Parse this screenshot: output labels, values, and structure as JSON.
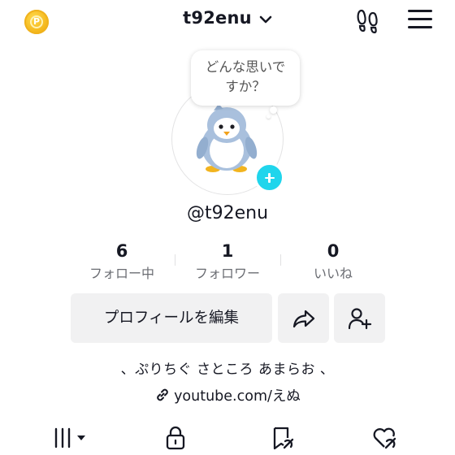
{
  "header": {
    "coin_icon": "coin-icon",
    "username": "t92enu",
    "dropdown_icon": "chevron-down-icon",
    "footprint_icon": "footprints-icon",
    "menu_icon": "hamburger-menu-icon"
  },
  "profile": {
    "thought_bubble": "どんな思いで\nすか？",
    "avatar": "penguin-avatar",
    "add_icon": "plus-icon",
    "handle": "@t92enu"
  },
  "stats": [
    {
      "value": "6",
      "label": "フォロー中"
    },
    {
      "value": "1",
      "label": "フォロワー"
    },
    {
      "value": "0",
      "label": "いいね"
    }
  ],
  "actions": {
    "edit_profile": "プロフィールを編集",
    "share_icon": "share-arrow-icon",
    "add_friend_icon": "add-friend-icon"
  },
  "bio": "、ぷりちぐ さところ あまらお 、",
  "link": {
    "icon": "link-icon",
    "text": "youtube.com/えぬ"
  },
  "tabs": [
    {
      "icon": "video-grid-icon",
      "active": true
    },
    {
      "icon": "lock-icon",
      "active": false
    },
    {
      "icon": "bookmark-icon",
      "active": false
    },
    {
      "icon": "liked-heart-icon",
      "active": false
    }
  ],
  "colors": {
    "accent_cyan": "#20d5ec",
    "text_primary": "#161823",
    "text_secondary": "#6b6d73",
    "button_bg": "#f1f1f2",
    "coin_gold": "#f3b417"
  }
}
